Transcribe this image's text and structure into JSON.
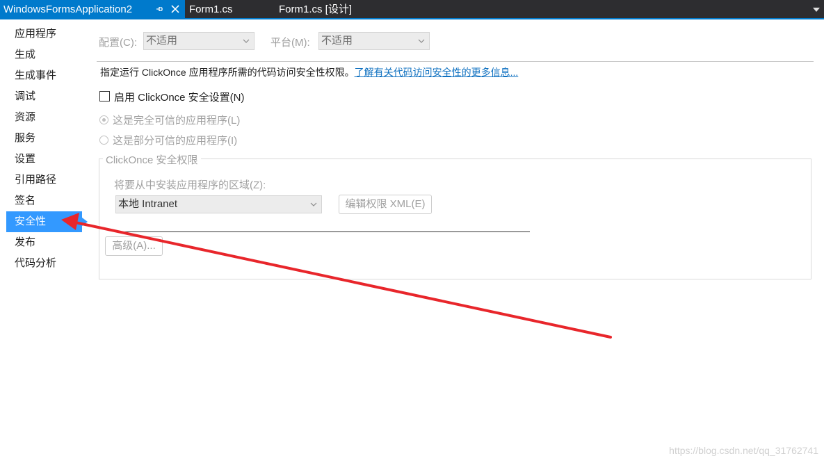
{
  "tabs": [
    {
      "label": "WindowsFormsApplication2",
      "active": true
    },
    {
      "label": "Form1.cs",
      "active": false
    },
    {
      "label": "Form1.cs [设计]",
      "active": false
    }
  ],
  "sidebar": {
    "items": [
      {
        "label": "应用程序"
      },
      {
        "label": "生成"
      },
      {
        "label": "生成事件"
      },
      {
        "label": "调试"
      },
      {
        "label": "资源"
      },
      {
        "label": "服务"
      },
      {
        "label": "设置"
      },
      {
        "label": "引用路径"
      },
      {
        "label": "签名"
      },
      {
        "label": "安全性",
        "selected": true
      },
      {
        "label": "发布"
      },
      {
        "label": "代码分析"
      }
    ]
  },
  "config": {
    "config_label": "配置(C):",
    "config_value": "不适用",
    "platform_label": "平台(M):",
    "platform_value": "不适用"
  },
  "description": {
    "text": "指定运行 ClickOnce 应用程序所需的代码访问安全性权限。",
    "link": "了解有关代码访问安全性的更多信息..."
  },
  "security": {
    "enable_checkbox_label": "启用 ClickOnce 安全设置(N)",
    "enable_checked": false,
    "radio_full_trust": "这是完全可信的应用程序(L)",
    "radio_partial_trust": "这是部分可信的应用程序(I)",
    "selected_radio": "full_trust"
  },
  "permissions_group": {
    "title": "ClickOnce 安全权限",
    "zone_label": "将要从中安装应用程序的区域(Z):",
    "zone_value": "本地 Intranet",
    "edit_xml_button": "编辑权限 XML(E)",
    "advanced_button": "高级(A)..."
  },
  "watermark": "https://blog.csdn.net/qq_31762741",
  "colors": {
    "accent": "#007acc",
    "tab_bar": "#2d2d30",
    "selected_item": "#3399ff",
    "annotation_arrow": "#e8262b",
    "link": "#0e70c0"
  }
}
